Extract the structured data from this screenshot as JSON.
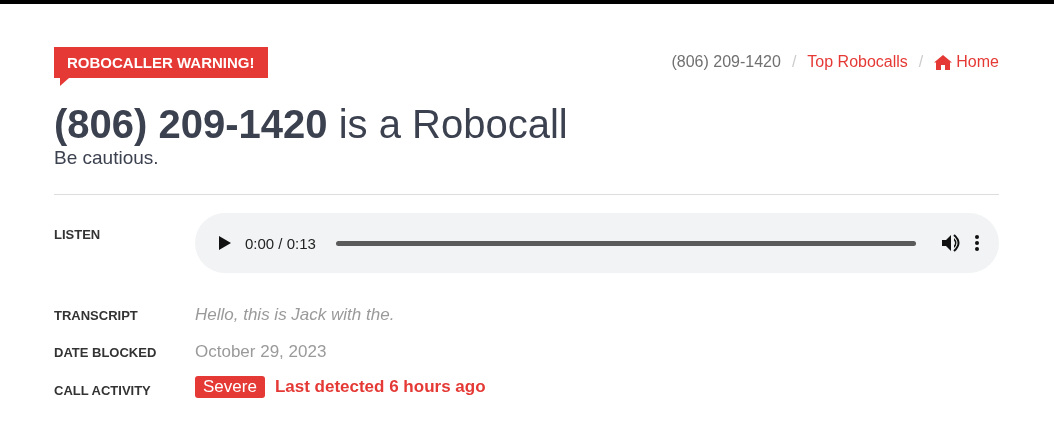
{
  "badge": "ROBOCALLER WARNING!",
  "breadcrumb_separator": "/",
  "breadcrumb": [
    {
      "kind": "text",
      "label": "(806) 209-1420"
    },
    {
      "kind": "link",
      "label": "Top Robocalls"
    },
    {
      "kind": "home",
      "label": "Home"
    }
  ],
  "heading": {
    "number": "(806) 209-1420",
    "rest": "is a Robocall"
  },
  "subtitle": "Be cautious.",
  "details": [
    {
      "kind": "audio",
      "label": "LISTEN",
      "time": "0:00 / 0:13"
    },
    {
      "kind": "italic",
      "label": "TRANSCRIPT",
      "value": "Hello, this is Jack with the."
    },
    {
      "kind": "text",
      "label": "DATE BLOCKED",
      "value": "October 29, 2023"
    },
    {
      "kind": "activity",
      "label": "CALL ACTIVITY",
      "tag": "Severe",
      "value": "Last detected 6 hours ago"
    }
  ]
}
